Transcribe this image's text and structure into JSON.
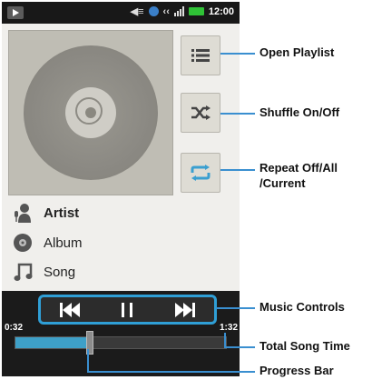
{
  "status_bar": {
    "time": "12:00"
  },
  "track": {
    "artist": "Artist",
    "album": "Album",
    "song": "Song"
  },
  "playback": {
    "current_time": "0:32",
    "total_time": "1:32",
    "progress": 0.35
  },
  "callouts": {
    "open_playlist": "Open Playlist",
    "shuffle": "Shuffle On/Off",
    "repeat_line1": "Repeat Off/All",
    "repeat_line2": "/Current",
    "music_controls": "Music Controls",
    "total_song_time": "Total Song Time",
    "progress_bar": "Progress Bar"
  },
  "icons": {
    "notification": "play-notification-icon",
    "volume": "speaker-icon",
    "network": "globe-icon",
    "signal": "signal-icon",
    "battery": "battery-icon",
    "playlist": "list-icon",
    "shuffle": "shuffle-icon",
    "repeat": "repeat-icon",
    "artist": "person-mic-icon",
    "album": "disc-icon",
    "song": "music-note-icon",
    "previous": "skip-previous-icon",
    "pause": "pause-icon",
    "next": "skip-next-icon"
  },
  "colors": {
    "accent": "#2f9fd6",
    "progress": "#3ea0c8",
    "battery": "#2fc236"
  }
}
